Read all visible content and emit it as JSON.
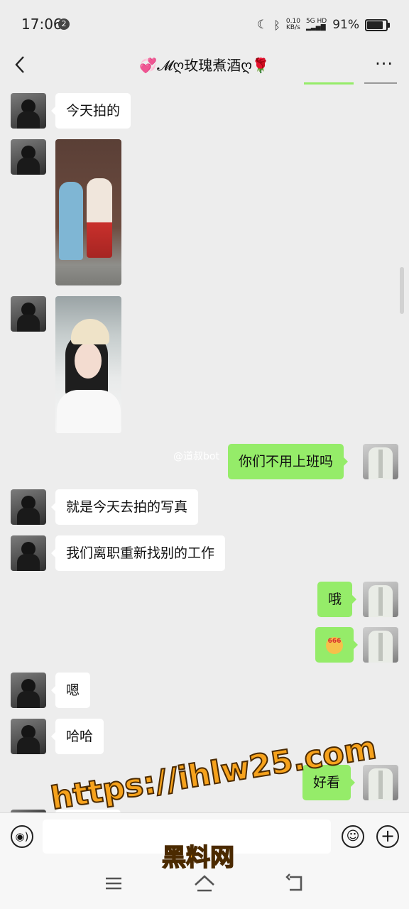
{
  "status_bar": {
    "time": "17:06",
    "notif_count": "2",
    "net_speed_value": "0.10",
    "net_speed_unit": "KB/s",
    "network": "5G HD",
    "battery": "91%"
  },
  "header": {
    "title": "💞𝓜ღ玫瑰煮酒ღ🌹"
  },
  "messages": [
    {
      "side": "in",
      "type": "text",
      "text": "今天拍的"
    },
    {
      "side": "in",
      "type": "image",
      "alt": "photo"
    },
    {
      "side": "in",
      "type": "image",
      "alt": "photo"
    },
    {
      "side": "out",
      "type": "text",
      "text": "你们不用上班吗"
    },
    {
      "side": "in",
      "type": "text",
      "text": "就是今天去拍的写真"
    },
    {
      "side": "in",
      "type": "text",
      "text": "我们离职重新找别的工作"
    },
    {
      "side": "out",
      "type": "text",
      "text": "哦"
    },
    {
      "side": "out",
      "type": "sticker",
      "text": "666"
    },
    {
      "side": "in",
      "type": "text",
      "text": "嗯"
    },
    {
      "side": "in",
      "type": "text",
      "text": "哈哈"
    },
    {
      "side": "out",
      "type": "text",
      "text": "好看"
    }
  ],
  "weibo_watermark": "@道叔bot",
  "input_bar": {
    "voice_icon": "voice-icon",
    "emoji_icon": "emoji-icon",
    "plus_icon": "plus-icon",
    "placeholder": ""
  },
  "nav": {
    "menu_icon": "menu-icon",
    "home_icon": "home-icon",
    "back_icon": "back-icon"
  },
  "overlay": {
    "url": "https://ihlw25.com",
    "name": "黑料网"
  },
  "colors": {
    "background": "#ededed",
    "outgoing_bubble": "#95ec69",
    "incoming_bubble": "#ffffff",
    "watermark": "#f6a21c"
  }
}
